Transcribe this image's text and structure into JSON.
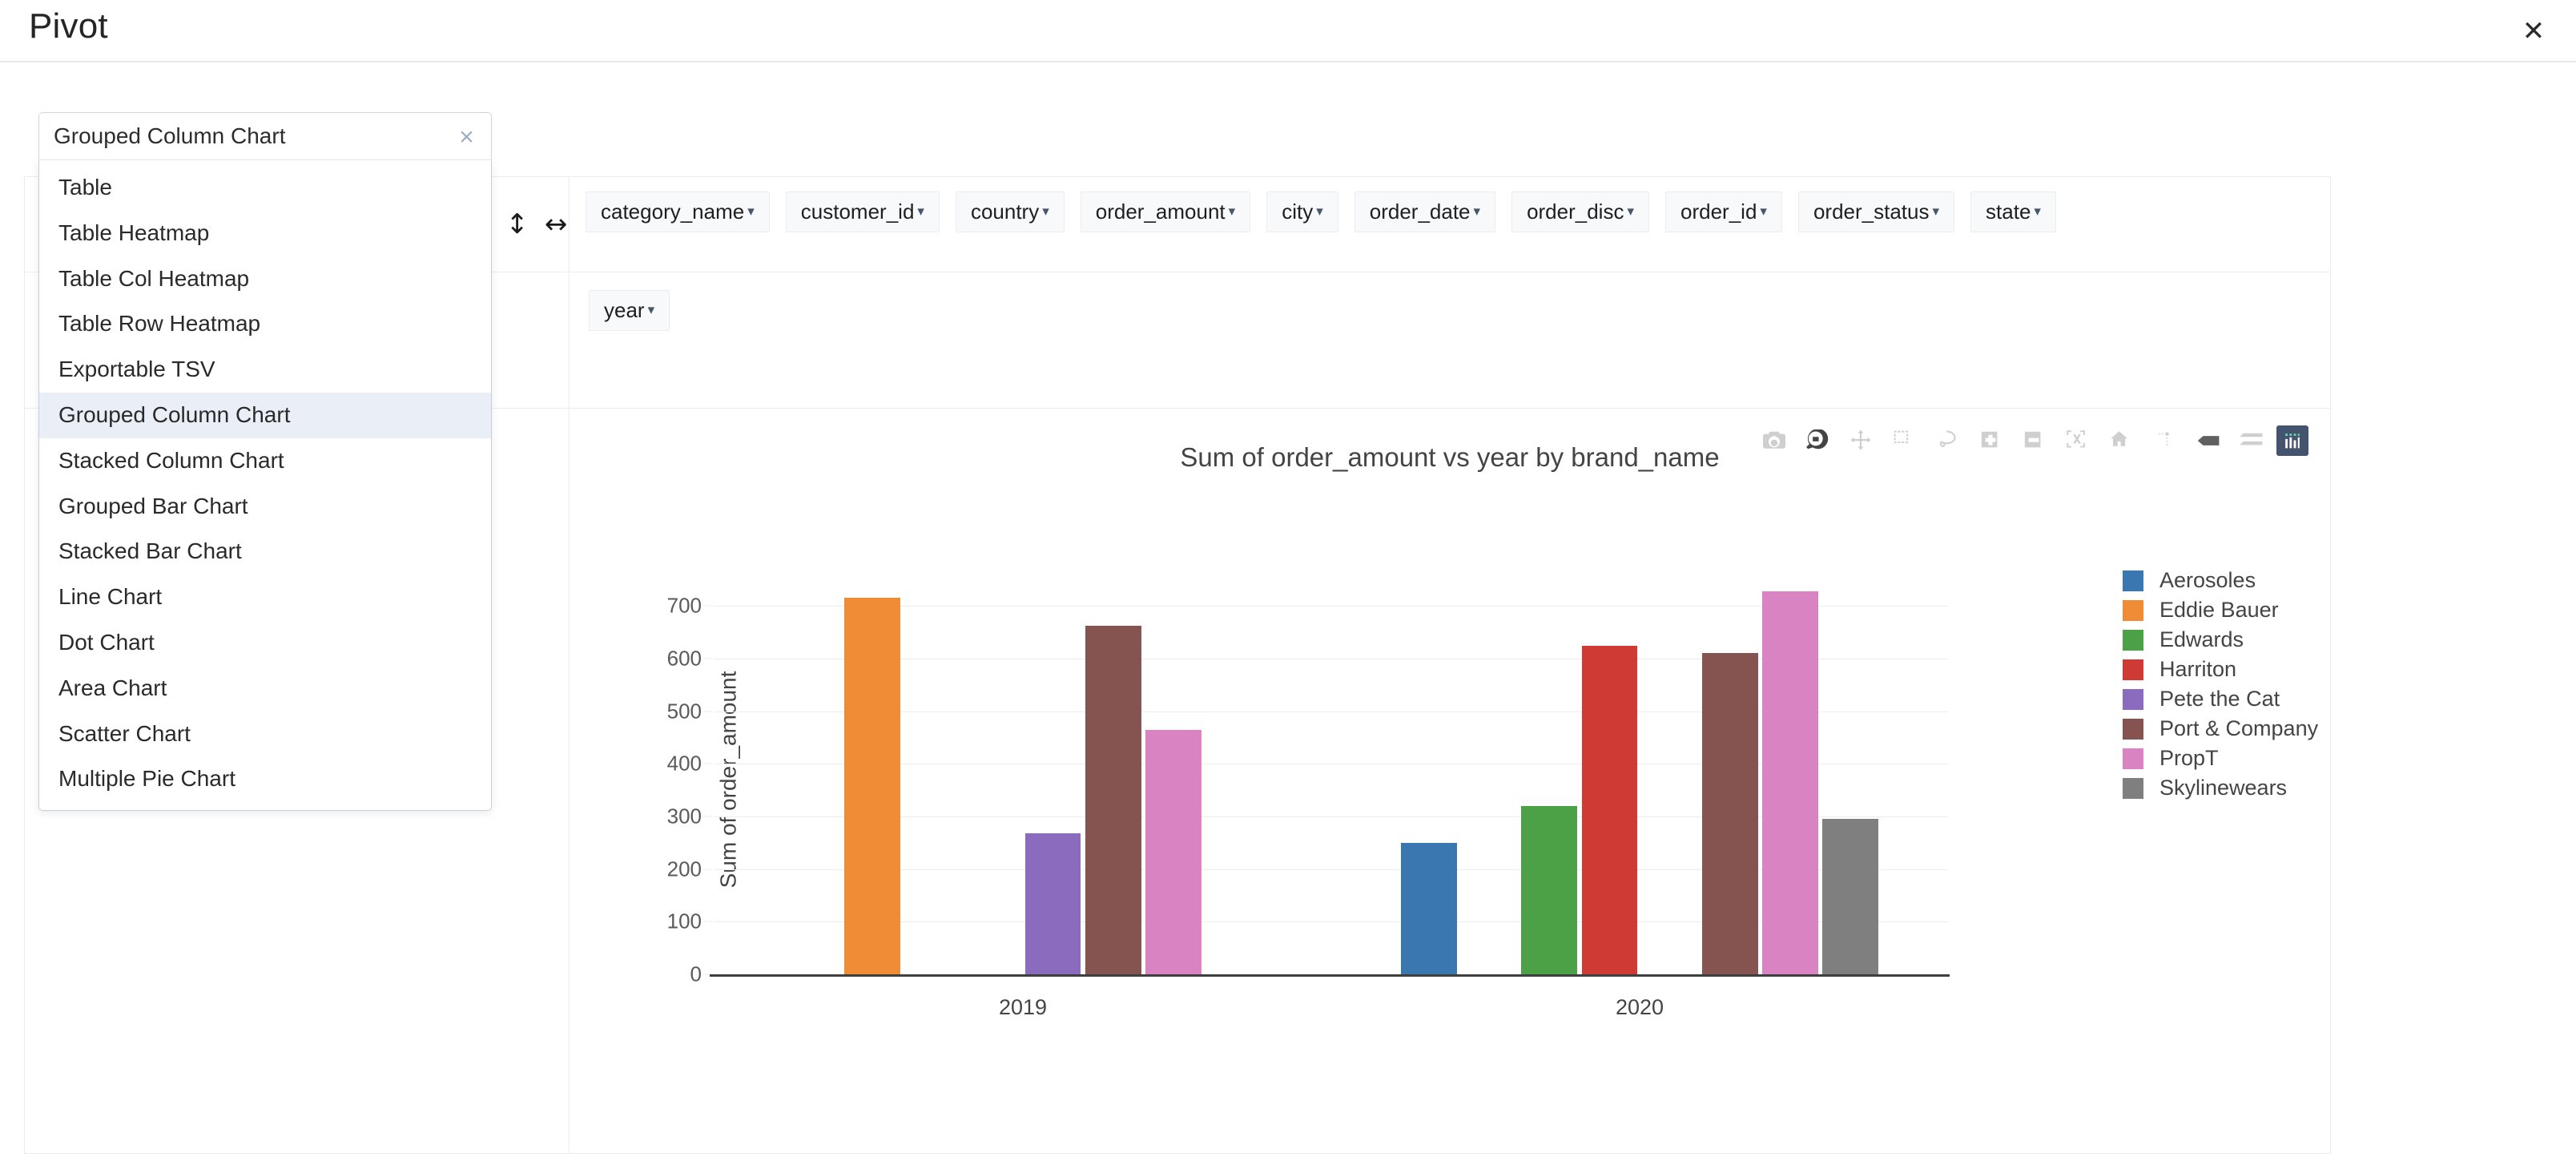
{
  "header": {
    "title": "Pivot",
    "close_label": "✕"
  },
  "renderer": {
    "selected": "Grouped Column Chart",
    "clear_label": "×",
    "options": [
      "Table",
      "Table Heatmap",
      "Table Col Heatmap",
      "Table Row Heatmap",
      "Exportable TSV",
      "Grouped Column Chart",
      "Stacked Column Chart",
      "Grouped Bar Chart",
      "Stacked Bar Chart",
      "Line Chart",
      "Dot Chart",
      "Area Chart",
      "Scatter Chart",
      "Multiple Pie Chart"
    ]
  },
  "axis_controls": {
    "vertical_icon": "↕",
    "horizontal_icon": "↔"
  },
  "unused_fields": [
    "category_name",
    "customer_id",
    "country",
    "order_amount",
    "city",
    "order_date",
    "order_disc",
    "order_id",
    "order_status",
    "state"
  ],
  "column_fields": [
    "year"
  ],
  "aggregator": {
    "caret": "▾"
  },
  "caret": "▾",
  "modebar": {
    "buttons": [
      "camera-icon",
      "zoom-icon",
      "pan-icon",
      "box-select-icon",
      "lasso-select-icon",
      "zoom-in-icon",
      "zoom-out-icon",
      "autoscale-icon",
      "reset-axes-icon",
      "toggle-spikelines-icon",
      "hover-compare-icon",
      "hover-closest-icon",
      "plotly-logo-icon"
    ],
    "active": "zoom-icon",
    "highlight_color": "#44546e"
  },
  "chart_data": {
    "type": "bar",
    "title": "Sum of order_amount vs year by brand_name",
    "xlabel": "",
    "ylabel": "Sum of order_amount",
    "categories": [
      "2019",
      "2020"
    ],
    "ylim": [
      0,
      740
    ],
    "yticks": [
      0,
      100,
      200,
      300,
      400,
      500,
      600,
      700
    ],
    "grid": true,
    "legend_position": "right",
    "barmode": "group",
    "series": [
      {
        "name": "Aerosoles",
        "color": "#3a76af",
        "values": [
          null,
          249
        ]
      },
      {
        "name": "Eddie Bauer",
        "color": "#ef8c35",
        "values": [
          715,
          null
        ]
      },
      {
        "name": "Edwards",
        "color": "#4ca147",
        "values": [
          null,
          320
        ]
      },
      {
        "name": "Harriton",
        "color": "#cf3b34",
        "values": [
          null,
          624
        ]
      },
      {
        "name": "Pete the Cat",
        "color": "#8a6bbd",
        "values": [
          268,
          null
        ]
      },
      {
        "name": "Port & Company",
        "color": "#855450",
        "values": [
          662,
          611
        ]
      },
      {
        "name": "PropT",
        "color": "#d983c2",
        "values": [
          465,
          728
        ]
      },
      {
        "name": "Skylinewears",
        "color": "#7f7f7f",
        "values": [
          null,
          295
        ]
      }
    ]
  }
}
